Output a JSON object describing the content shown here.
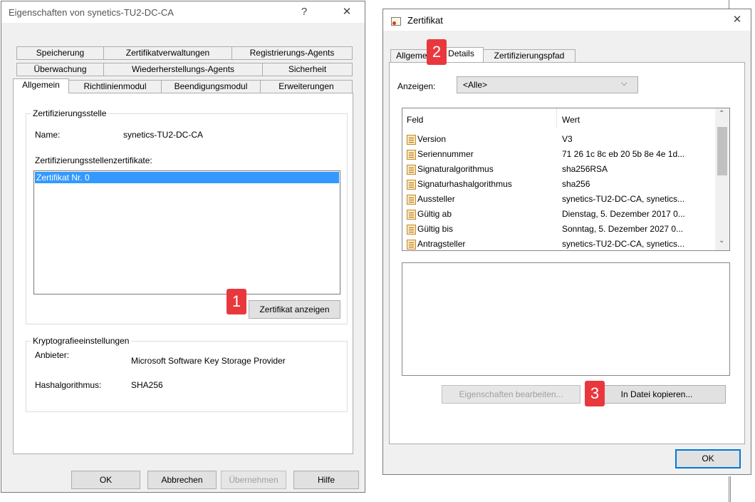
{
  "left_dialog": {
    "title": "Eigenschaften von synetics-TU2-DC-CA",
    "help_btn": "?",
    "close_btn": "✕",
    "tabs_row1": [
      "Speicherung",
      "Zertifikatverwaltungen",
      "Registrierungs-Agents"
    ],
    "tabs_row2": [
      "Überwachung",
      "Wiederherstellungs-Agents",
      "Sicherheit"
    ],
    "tabs_row3": [
      "Allgemein",
      "Richtlinienmodul",
      "Beendigungsmodul",
      "Erweiterungen"
    ],
    "ca_group": "Zertifizierungsstelle",
    "name_label": "Name:",
    "name_value": "synetics-TU2-DC-CA",
    "certs_label": "Zertifizierungsstellenzertifikate:",
    "certs_list": [
      "Zertifikat Nr. 0"
    ],
    "view_cert_btn": "Zertifikat anzeigen",
    "crypto_group": "Kryptografieeinstellungen",
    "provider_label": "Anbieter:",
    "provider_value": "Microsoft Software Key Storage Provider",
    "hash_label": "Hashalgorithmus:",
    "hash_value": "SHA256",
    "ok_btn": "OK",
    "cancel_btn": "Abbrechen",
    "apply_btn": "Übernehmen",
    "help2_btn": "Hilfe"
  },
  "right_dialog": {
    "title": "Zertifikat",
    "close_btn": "✕",
    "tabs": [
      "Allgemein",
      "Details",
      "Zertifizierungspfad"
    ],
    "show_label": "Anzeigen:",
    "show_value": "<Alle>",
    "col_field": "Feld",
    "col_value": "Wert",
    "rows": [
      {
        "field": "Version",
        "value": "V3"
      },
      {
        "field": "Seriennummer",
        "value": "71 26 1c 8c eb 20 5b 8e 4e 1d..."
      },
      {
        "field": "Signaturalgorithmus",
        "value": "sha256RSA"
      },
      {
        "field": "Signaturhashalgorithmus",
        "value": "sha256"
      },
      {
        "field": "Aussteller",
        "value": "synetics-TU2-DC-CA, synetics..."
      },
      {
        "field": "Gültig ab",
        "value": "Dienstag, 5. Dezember 2017 0..."
      },
      {
        "field": "Gültig bis",
        "value": "Sonntag, 5. Dezember 2027 0..."
      },
      {
        "field": "Antragsteller",
        "value": "synetics-TU2-DC-CA, synetics..."
      }
    ],
    "edit_props_btn": "Eigenschaften bearbeiten...",
    "copy_file_btn": "In Datei kopieren...",
    "ok_btn": "OK"
  },
  "badges": {
    "one": "1",
    "two": "2",
    "three": "3"
  },
  "colors": {
    "selection": "#3399ff",
    "badge": "#e8383d",
    "accent": "#0078d7"
  }
}
